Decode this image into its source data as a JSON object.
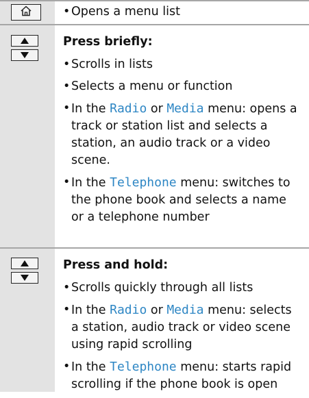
{
  "rows": [
    {
      "keys": [
        "home"
      ],
      "items": [
        [
          "Opens a menu list"
        ]
      ]
    },
    {
      "keys": [
        "up",
        "down"
      ],
      "heading": "Press briefly:",
      "items": [
        [
          "Scrolls in lists"
        ],
        [
          "Selects a menu or function"
        ],
        [
          "In the ",
          "Radio",
          " or ",
          "Media",
          " menu: opens a track or station list and selects a station, an audio track or a video scene."
        ],
        [
          "In the ",
          "Telephone",
          " menu: switches to the phone book and selects a name or a telephone number"
        ]
      ]
    },
    {
      "keys": [
        "up",
        "down"
      ],
      "heading": "Press and hold:",
      "items": [
        [
          "Scrolls quickly through all lists"
        ],
        [
          "In the ",
          "Radio",
          " or ",
          "Media",
          " menu: selects a station, audio track or video scene using rapid scrolling"
        ],
        [
          "In the ",
          "Telephone",
          " menu: starts rapid scrolling if the phone book is open"
        ]
      ]
    }
  ],
  "icons": {
    "home": "home-icon",
    "up": "triangle-up-icon",
    "down": "triangle-down-icon"
  },
  "colors": {
    "keyword": "#2d86c4",
    "key_column": "#e3e3e3",
    "divider": "#a6a6a6"
  }
}
